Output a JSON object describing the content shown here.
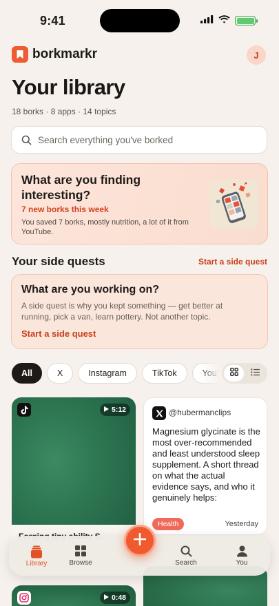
{
  "status_bar": {
    "time": "9:41"
  },
  "header": {
    "app_name": "borkmarkr",
    "avatar_initial": "J"
  },
  "library": {
    "title": "Your library",
    "subtitle": "18 borks · 8 apps · 14 topics"
  },
  "search": {
    "placeholder": "Search everything you've borked"
  },
  "insight_card": {
    "title": "What are you finding interesting?",
    "highlight": "7 new borks this week",
    "description": "You saved 7 borks, mostly nutrition, a lot of it from YouTube."
  },
  "side_quests": {
    "title": "Your side quests",
    "link": "Start a side quest",
    "card": {
      "title": "What are you working on?",
      "description": "A side quest is why you kept something — get better at running, pick a van, learn pottery. Not another topic.",
      "cta": "Start a side quest"
    }
  },
  "filters": {
    "chips": [
      {
        "label": "All",
        "active": true
      },
      {
        "label": "X",
        "active": false
      },
      {
        "label": "Instagram",
        "active": false
      },
      {
        "label": "TikTok",
        "active": false
      },
      {
        "label": "YouTube",
        "active": false
      }
    ],
    "view_mode": "grid"
  },
  "cards": [
    {
      "source_icon": "tiktok-icon",
      "duration": "5:12",
      "caption": "Forging tiny ability S..."
    },
    {
      "source_icon": "x-icon",
      "handle": "@hubermanclips",
      "body": "Magnesium glycinate is the most over-recommended and least understood sleep supplement. A short thread on what the actual evidence says, and who it genuinely helps:",
      "tag": "Health",
      "time": "Yesterday"
    },
    {
      "source_icon": "instagram-icon",
      "duration": "0:48"
    }
  ],
  "tab_bar": {
    "tabs": [
      {
        "label": "Library",
        "icon": "library-icon",
        "active": true
      },
      {
        "label": "Browse",
        "icon": "grid-icon",
        "active": false
      },
      {
        "label": "Search",
        "icon": "search-icon",
        "active": false
      },
      {
        "label": "You",
        "icon": "person-icon",
        "active": false
      }
    ],
    "fab_icon": "plus-icon"
  },
  "colors": {
    "accent": "#ef5b32",
    "background": "#f6f1ec",
    "tag_health": "#f06a5a",
    "card_green": "#2c7350"
  }
}
